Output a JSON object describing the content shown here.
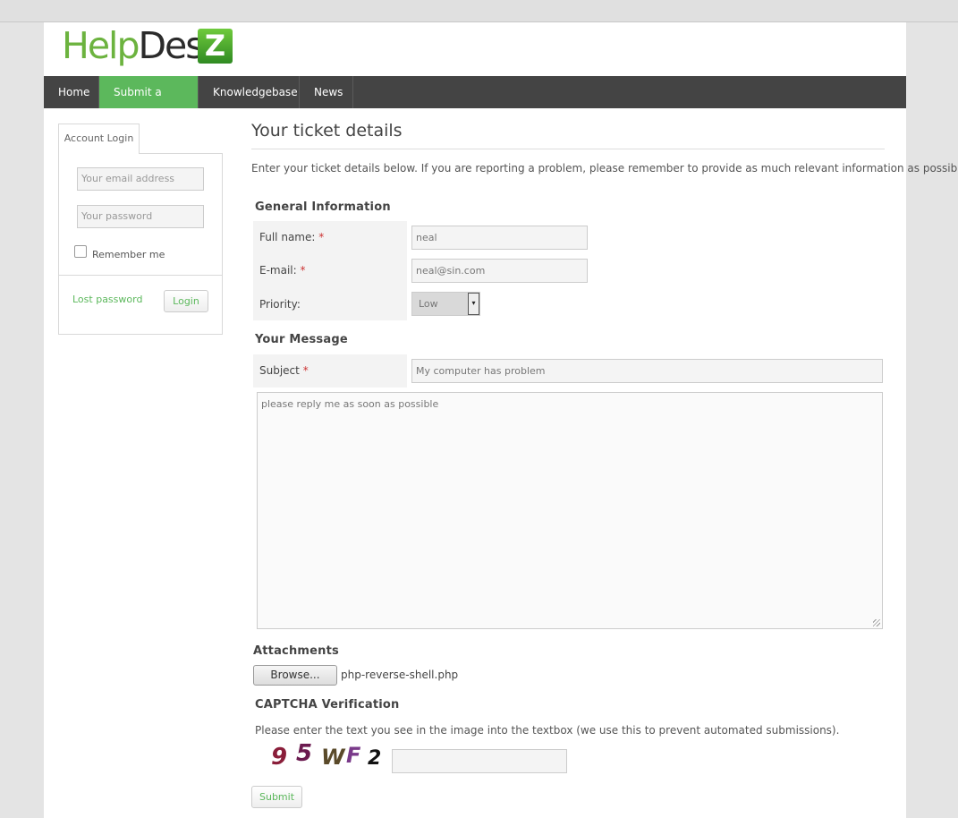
{
  "logo": {
    "part1": "Help",
    "part2": "Desk",
    "badge": "Z"
  },
  "nav": {
    "items": [
      "Home",
      "Submit a Ticket",
      "Knowledgebase",
      "News"
    ],
    "active": "Submit a Ticket"
  },
  "sidebar": {
    "tab_label": "Account Login",
    "email_placeholder": "Your email address",
    "password_placeholder": "Your password",
    "remember_label": "Remember me",
    "lost_password": "Lost password",
    "login_button": "Login"
  },
  "main": {
    "title": "Your ticket details",
    "intro": "Enter your ticket details below. If you are reporting a problem, please remember to provide as much relevant information as possible.",
    "general_heading": "General Information",
    "fullname_label": "Full name:",
    "fullname_value": "neal",
    "email_label": "E-mail:",
    "email_value": "neal@sin.com",
    "priority_label": "Priority:",
    "priority_value": "Low",
    "message_heading": "Your Message",
    "subject_label": "Subject",
    "subject_value": "My computer has problem",
    "message_value": "please reply me as soon as possible",
    "required_mark": "*",
    "attachments_heading": "Attachments",
    "browse_button": "Browse...",
    "attachment_filename": "php-reverse-shell.php",
    "captcha_heading": "CAPTCHA Verification",
    "captcha_instructions": "Please enter the text you see in the image into the textbox (we use this to prevent automated submissions).",
    "captcha_chars": [
      "9",
      "5",
      "W",
      "F",
      "2"
    ],
    "submit_button": "Submit"
  },
  "colors": {
    "accent": "#5cb85c",
    "navbar": "#444444",
    "required": "#cc3333"
  }
}
